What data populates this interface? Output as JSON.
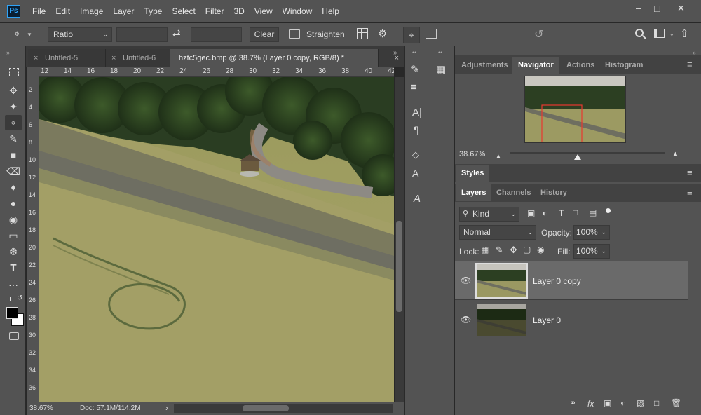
{
  "app": {
    "logo": "Ps"
  },
  "menu": [
    "File",
    "Edit",
    "Image",
    "Layer",
    "Type",
    "Select",
    "Filter",
    "3D",
    "View",
    "Window",
    "Help"
  ],
  "window_controls": {
    "minimize": "–",
    "maximize": "□",
    "close": "✕"
  },
  "options": {
    "ratio_label": "Ratio",
    "swap_icon": "⇄",
    "clear_label": "Clear",
    "straighten_label": "Straighten",
    "reset_icon": "↺"
  },
  "tabs": [
    {
      "label": "Untitled-5",
      "close": "×"
    },
    {
      "label": "Untitled-6",
      "close": "×"
    },
    {
      "label": "hztc5gec.bmp @ 38.7% (Layer 0 copy, RGB/8) *",
      "close": "×"
    }
  ],
  "rulers": {
    "horizontal": [
      "12",
      "14",
      "16",
      "18",
      "20",
      "22",
      "24",
      "26",
      "28",
      "30",
      "32",
      "34",
      "36",
      "38",
      "40",
      "42"
    ],
    "vertical": [
      "2",
      "4",
      "6",
      "8",
      "10",
      "12",
      "14",
      "16",
      "18",
      "20",
      "22",
      "24",
      "26",
      "28",
      "30",
      "32",
      "34",
      "36"
    ]
  },
  "status": {
    "zoom": "38.67%",
    "doc": "Doc: 57.1M/114.2M",
    "arrow": "›"
  },
  "panels": {
    "top_tabs": [
      "Adjustments",
      "Navigator",
      "Actions",
      "Histogram"
    ],
    "navigator_zoom": "38.67%",
    "styles_label": "Styles",
    "layer_tabs": [
      "Layers",
      "Channels",
      "History"
    ],
    "filter_kind": "Kind",
    "blend_mode": "Normal",
    "opacity_label": "Opacity:",
    "opacity_value": "100%",
    "lock_label": "Lock:",
    "fill_label": "Fill:",
    "fill_value": "100%",
    "menu_icon": "≡"
  },
  "layers": [
    {
      "name": "Layer 0 copy",
      "selected": true
    },
    {
      "name": "Layer 0",
      "selected": false
    }
  ],
  "colors": {
    "accent": "#31a8ff",
    "nav_box": "#e8382f"
  }
}
